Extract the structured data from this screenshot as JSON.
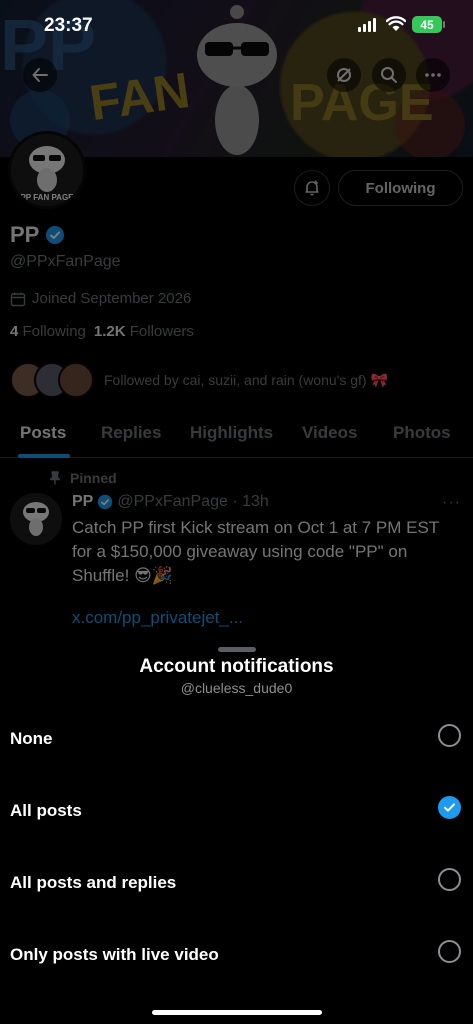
{
  "status_bar": {
    "time": "23:37",
    "battery": "45"
  },
  "banner": {
    "art_text_1": "PP",
    "art_text_2": "FAN",
    "art_text_3": "PAGE"
  },
  "profile": {
    "avatar_text": "PP FAN PAGE",
    "name": "PP",
    "handle": "@PPxFanPage",
    "joined": "Joined September 2026",
    "following_count": "4",
    "following_label": "Following",
    "followers_count": "1.2K",
    "followers_label": "Followers",
    "followed_by": "Followed by cai, suzii, and rain (wonu's gf) 🎀",
    "following_button": "Following"
  },
  "tabs": [
    {
      "label": "Posts"
    },
    {
      "label": "Replies"
    },
    {
      "label": "Highlights"
    },
    {
      "label": "Videos"
    },
    {
      "label": "Photos"
    }
  ],
  "pinned_post": {
    "pinned_label": "Pinned",
    "author": "PP",
    "handle_time": "@PPxFanPage · 13h",
    "text": "Catch PP first Kick stream on Oct 1 at 7 PM EST for a $150,000 giveaway using code \"PP\" on Shuffle! 😎🎉",
    "link": "x.com/pp_privatejet_...",
    "more": "···"
  },
  "sheet": {
    "title": "Account notifications",
    "subtitle": "@clueless_dude0",
    "options": [
      {
        "label": "None",
        "selected": false
      },
      {
        "label": "All posts",
        "selected": true
      },
      {
        "label": "All posts and replies",
        "selected": false
      },
      {
        "label": "Only posts with live video",
        "selected": false
      }
    ]
  },
  "colors": {
    "accent": "#1d9bf0",
    "background": "#000000",
    "muted_text": "#71767b"
  }
}
